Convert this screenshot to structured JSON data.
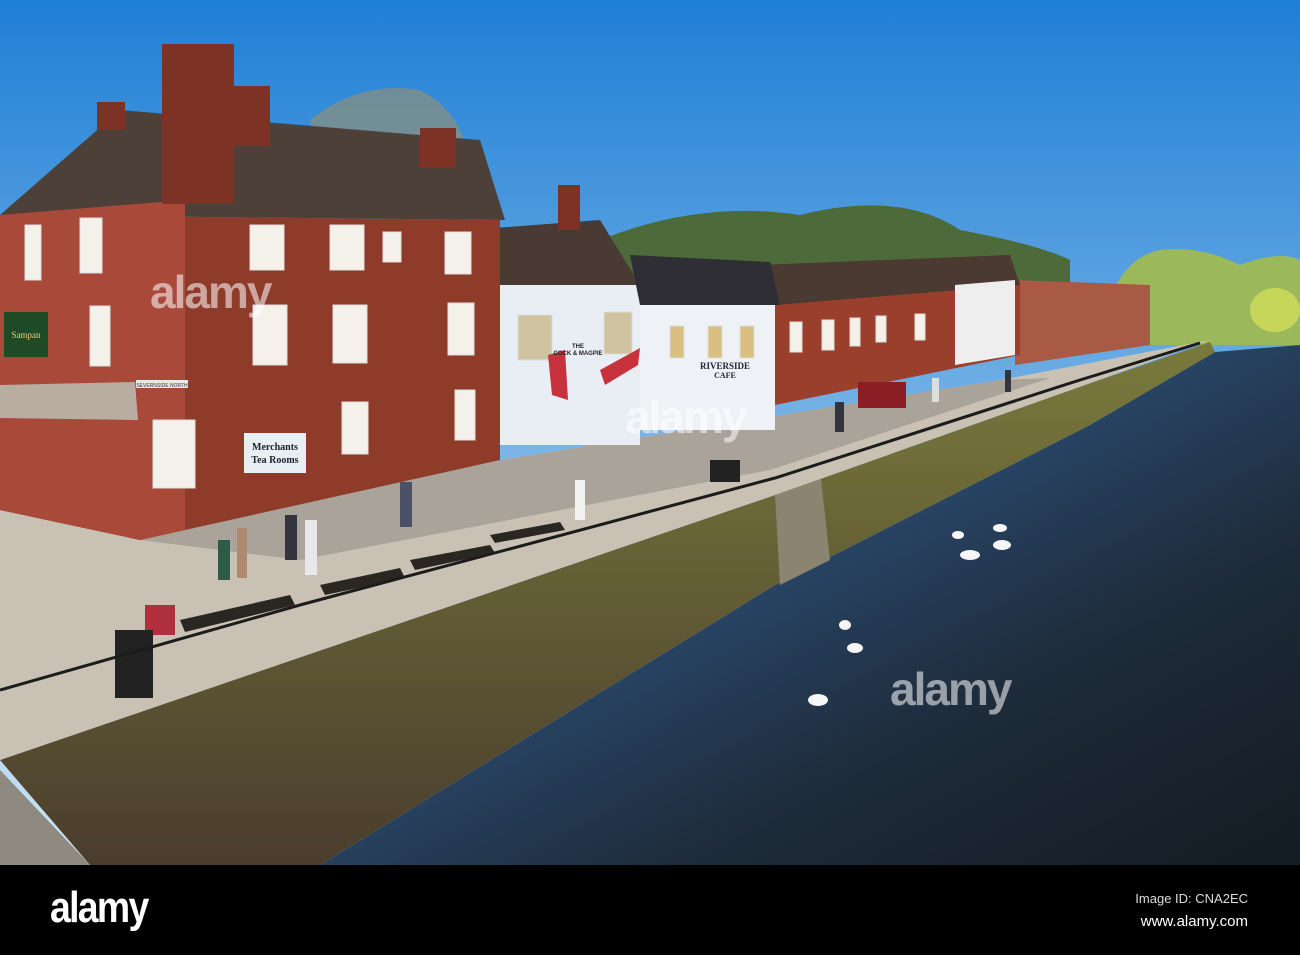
{
  "scene": {
    "signs": {
      "restaurant_sign": "Sampan",
      "street_sign": "SEVERNSIDE NORTH",
      "tea_rooms_line1": "Merchants",
      "tea_rooms_line2": "Tea Rooms",
      "pub_line1": "THE",
      "pub_line2": "COCK & MAGPIE",
      "cafe_line1": "RIVERSIDE",
      "cafe_line2": "CAFE"
    },
    "watermark": "alamy"
  },
  "footer": {
    "logo": "alamy",
    "image_id": "Image ID: CNA2EC",
    "website": "www.alamy.com"
  },
  "colors": {
    "sky_top": "#1f7fd6",
    "sky_bottom": "#cfe6f5",
    "brick": "#8e3b2a",
    "river": "#1d2a38",
    "wall": "#6a5a3c"
  }
}
